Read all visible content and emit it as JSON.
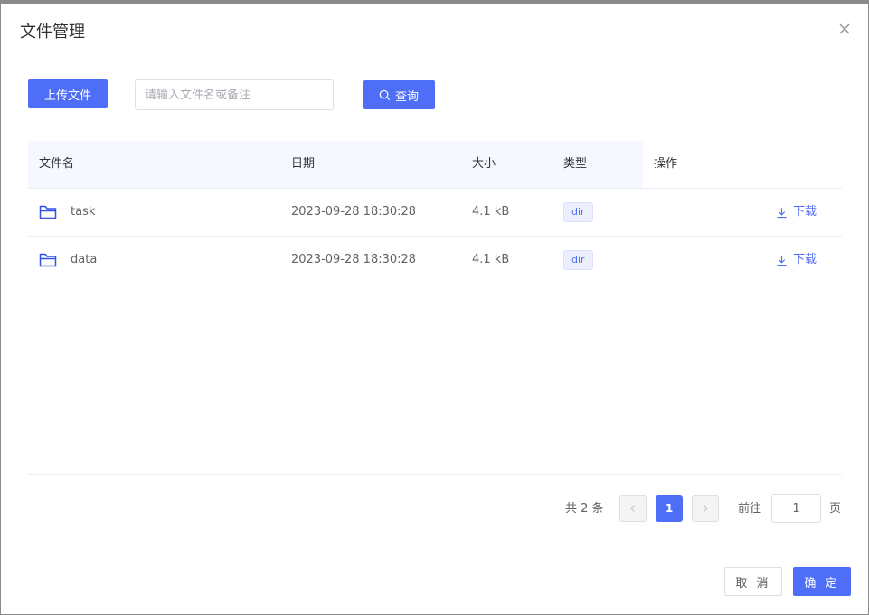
{
  "dialog": {
    "title": "文件管理"
  },
  "toolbar": {
    "upload_label": "上传文件",
    "search_placeholder": "请输入文件名或备注",
    "search_value": "",
    "query_label": "查询"
  },
  "table": {
    "columns": [
      "文件名",
      "日期",
      "大小",
      "类型",
      "操作"
    ],
    "rows": [
      {
        "name": "task",
        "date": "2023-09-28 18:30:28",
        "size": "4.1 kB",
        "type": "dir",
        "action": "下载"
      },
      {
        "name": "data",
        "date": "2023-09-28 18:30:28",
        "size": "4.1 kB",
        "type": "dir",
        "action": "下载"
      }
    ]
  },
  "pagination": {
    "total_label": "共 2 条",
    "current_page": "1",
    "goto_label": "前往",
    "goto_value": "1",
    "page_suffix": "页"
  },
  "footer": {
    "cancel_label": "取 消",
    "confirm_label": "确 定"
  },
  "colors": {
    "primary": "#4f6ef7",
    "header_bg": "#f5f8fe",
    "border": "#dcdfe6"
  },
  "icons": {
    "close": "close-icon",
    "search": "search-icon",
    "folder": "folder-icon",
    "download": "download-icon",
    "prev": "chevron-left-icon",
    "next": "chevron-right-icon"
  }
}
